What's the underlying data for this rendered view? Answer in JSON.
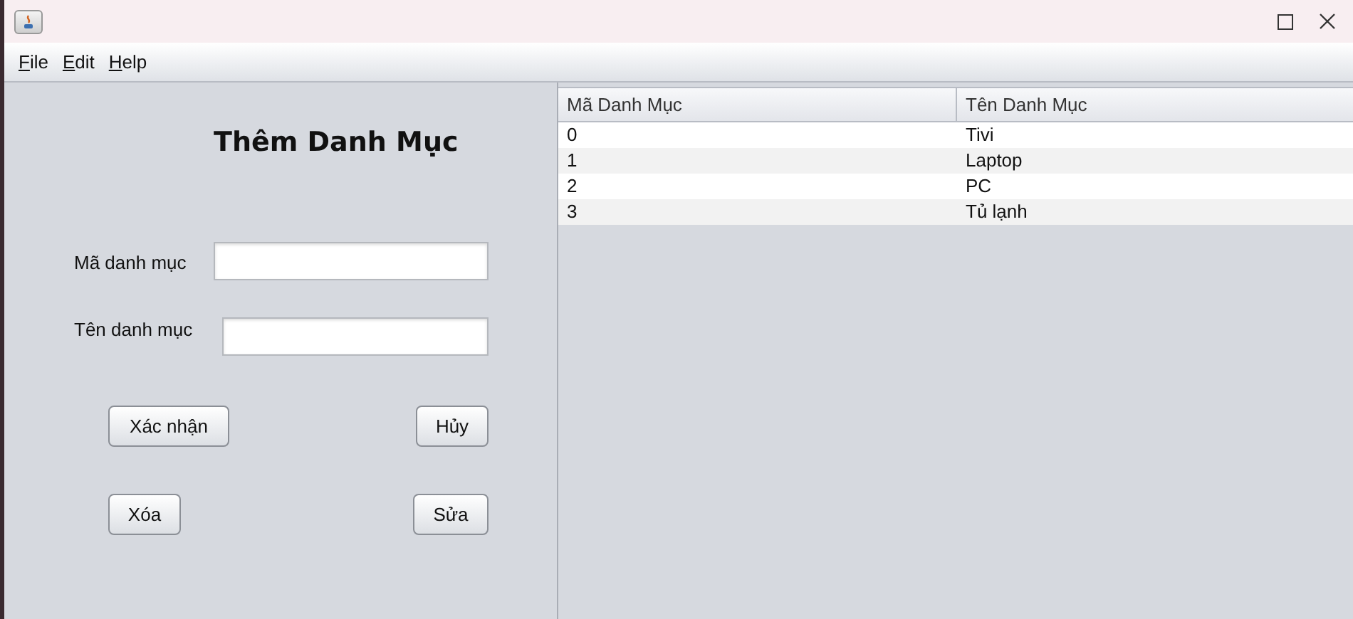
{
  "menu": [
    "File",
    "Edit",
    "Help"
  ],
  "form": {
    "title": "Thêm Danh Mục",
    "fields": [
      {
        "label": "Mã danh mục"
      },
      {
        "label": "Tên danh mục"
      }
    ],
    "buttons": [
      "Xác nhận",
      "Hủy",
      "Xóa",
      "Sửa"
    ]
  },
  "table": {
    "columns": [
      "Mã Danh Mục",
      "Tên Danh Mục"
    ],
    "rows": [
      [
        "0",
        "Tivi"
      ],
      [
        "1",
        "Laptop"
      ],
      [
        "2",
        "PC"
      ],
      [
        "3",
        "Tủ lạnh"
      ]
    ]
  }
}
